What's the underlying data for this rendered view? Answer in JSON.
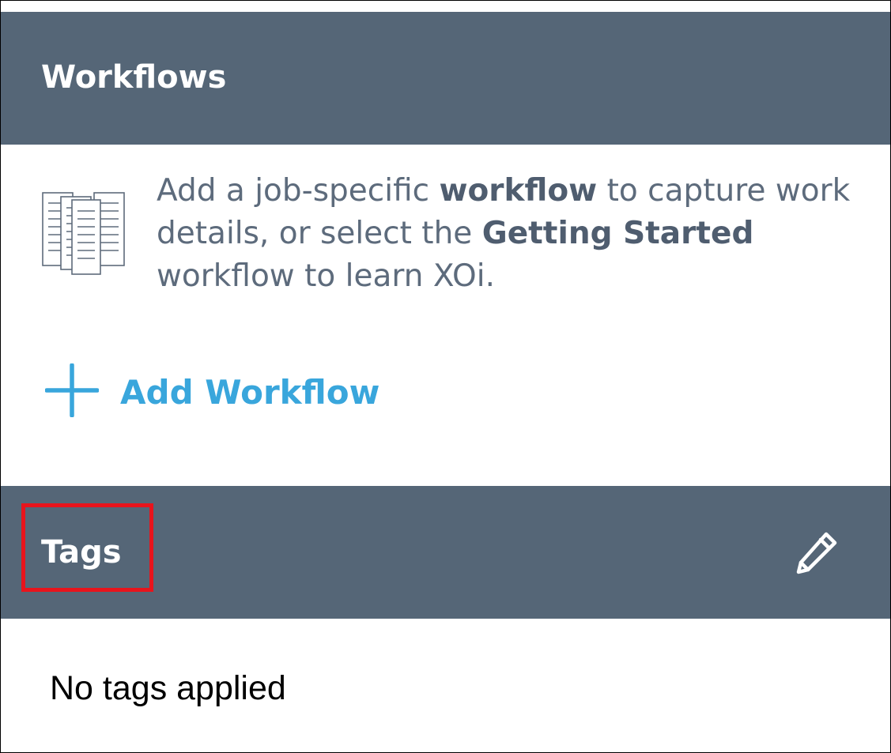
{
  "workflows": {
    "title": "Workflows",
    "description_parts": {
      "part1": "Add a job-specific ",
      "bold1": "workflow",
      "part2": " to capture work details, or select the ",
      "bold2": "Getting Started",
      "part3": " workflow to learn XOi."
    },
    "add_button_label": "Add Workflow",
    "icon": "document-stack-icon",
    "add_icon": "plus-icon"
  },
  "tags": {
    "title": "Tags",
    "edit_icon": "pencil-icon",
    "empty_text": "No tags applied"
  },
  "colors": {
    "header_bg": "#556677",
    "accent": "#39a6dc",
    "highlight": "#e8141c",
    "body_text": "#5d6b7c"
  }
}
